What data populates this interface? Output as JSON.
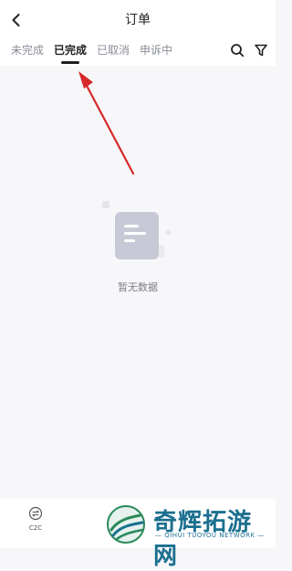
{
  "header": {
    "title": "订单",
    "back_icon": "back-chevron-icon"
  },
  "tabs": [
    {
      "label": "未完成",
      "active": false
    },
    {
      "label": "已完成",
      "active": true
    },
    {
      "label": "已取消",
      "active": false
    },
    {
      "label": "申诉中",
      "active": false
    }
  ],
  "tools": {
    "search_icon": "search-icon",
    "filter_icon": "filter-icon"
  },
  "empty": {
    "message": "暂无数据",
    "icon": "empty-document-icon"
  },
  "bottom": {
    "label": "C2C",
    "icon": "c2c-exchange-icon"
  },
  "watermark": {
    "text": "奇辉拓游网",
    "subtext": "— QIHUI TUOYOU NETWORK —"
  },
  "colors": {
    "arrow": "#d62a2a",
    "brand": "#1b6f8f"
  }
}
